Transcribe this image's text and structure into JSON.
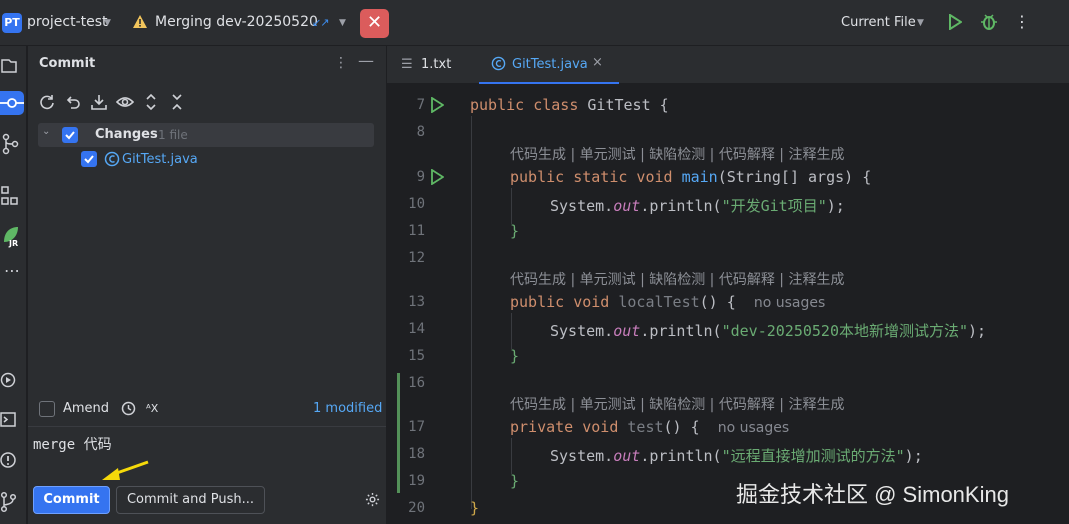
{
  "titlebar": {
    "project_badge": "PT",
    "project_name": "project-test",
    "merge_status": "Merging dev-20250520",
    "abort_icon": "close-icon",
    "run_config": "Current File",
    "accent": "#3574f0",
    "abort_color": "#db5c5c"
  },
  "commit_panel": {
    "title": "Commit",
    "changes_label": "Changes",
    "changes_count": "1 file",
    "file_name": "GitTest.java",
    "amend_label": "Amend",
    "ax_label": "ᴬX",
    "modified_link": "1 modified",
    "message": "merge 代码",
    "commit_button": "Commit",
    "commit_push_button": "Commit and Push..."
  },
  "editor": {
    "tabs": [
      {
        "label": "1.txt",
        "icon": "text-file-icon"
      },
      {
        "label": "GitTest.java",
        "icon": "java-class-icon",
        "close": "×"
      }
    ],
    "line_numbers": [
      "7",
      "8",
      "9",
      "10",
      "11",
      "12",
      "13",
      "14",
      "15",
      "16",
      "17",
      "18",
      "19",
      "20"
    ],
    "lens": "代码生成 | 单元测试 | 缺陷检测 | 代码解释 | 注释生成",
    "no_usages": "no usages",
    "code": {
      "l7_kw": "public class ",
      "l7_name": "GitTest {",
      "l9_kw": "public static void ",
      "l9_fn": "main",
      "l9_rest": "(String[] args) {",
      "sys": "System.",
      "out": "out",
      "println": ".println(",
      "l10_str": "\"开发Git项目\"",
      "end_stmt": ");",
      "close_brace": "}",
      "l13_kw": "public void ",
      "l13_fn": "localTest",
      "l13_rest": "() {",
      "l14_str": "\"dev-20250520本地新增测试方法\"",
      "l17_kw": "private void ",
      "l17_fn": "test",
      "l17_rest": "() {",
      "l18_str": "\"远程直接增加测试的方法\""
    }
  },
  "watermark": "掘金技术社区 @ SimonKing"
}
